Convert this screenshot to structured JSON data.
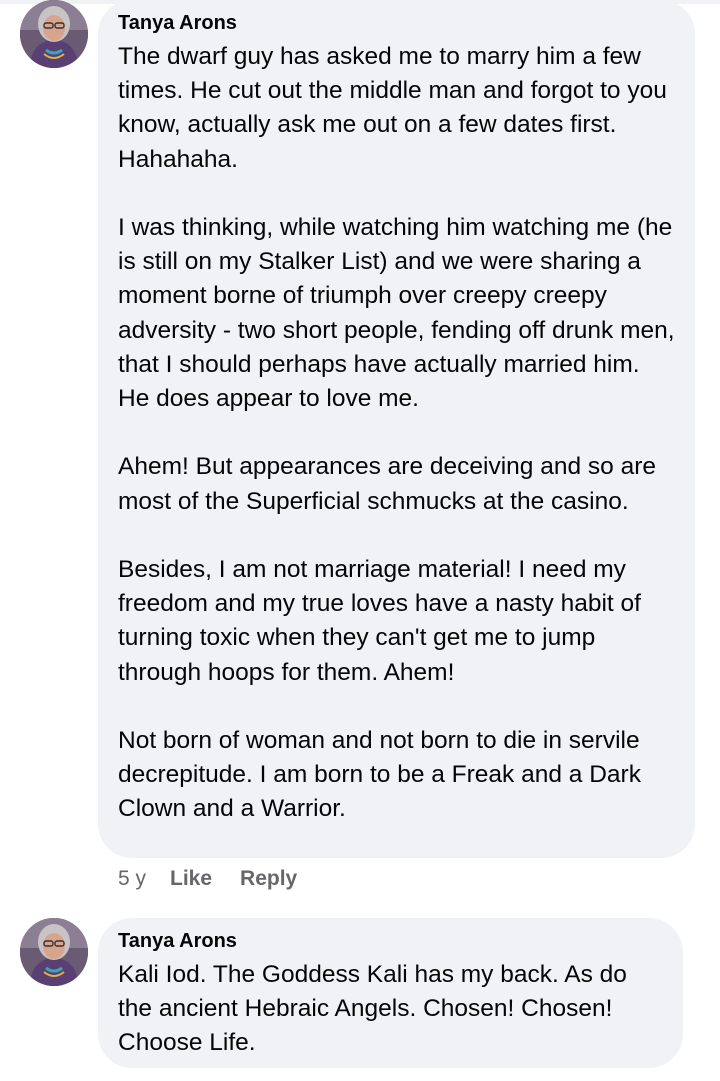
{
  "comments": [
    {
      "author": "Tanya Arons",
      "paragraphs": [
        "The dwarf guy has asked me to marry him a few times.  He cut out the middle man and forgot to you know, actually ask me out on a few dates first.  Hahahaha.",
        "I was thinking, while watching him watching me (he is still on my Stalker List) and we were sharing a moment borne of triumph over creepy creepy adversity - two short people, fending off drunk men, that I should perhaps have actually married him.  He does appear to love me.",
        "Ahem!  But appearances are deceiving and so are most of the Superficial schmucks at the casino.",
        "Besides, I am not marriage material!  I need my freedom and my true loves have a nasty habit of turning toxic when they can't get me to jump through hoops for them.  Ahem!",
        "Not born of woman and not born to die in servile decrepitude.  I am born to be a Freak and a Dark Clown and a Warrior."
      ],
      "time": "5 y",
      "like_label": "Like",
      "reply_label": "Reply"
    },
    {
      "author": "Tanya Arons",
      "paragraphs": [
        "Kali Iod.  The Goddess Kali has my back.  As do the ancient Hebraic Angels.  Chosen!  Chosen!  Choose Life."
      ]
    }
  ]
}
